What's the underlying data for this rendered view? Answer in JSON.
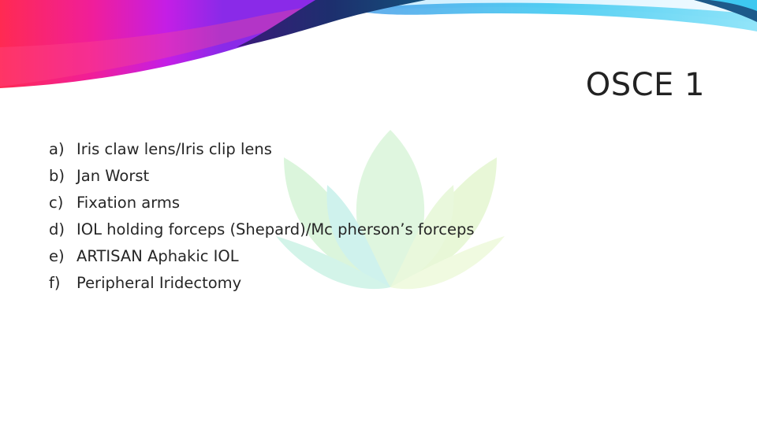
{
  "slide": {
    "title": "OSCE 1",
    "items": [
      {
        "marker": "a)",
        "text": "Iris claw lens/Iris clip lens"
      },
      {
        "marker": "b)",
        "text": "Jan Worst"
      },
      {
        "marker": "c)",
        "text": "Fixation arms"
      },
      {
        "marker": "d)",
        "text": "IOL holding forceps (Shepard)/Mc pherson’s forceps"
      },
      {
        "marker": "e)",
        "text": "ARTISAN Aphakic IOL"
      },
      {
        "marker": "f)",
        "text": "Peripheral Iridectomy"
      }
    ]
  },
  "colors": {
    "banner_left": "#ff1f5a",
    "banner_mid": "#c020e0",
    "banner_dark": "#1a2a6a",
    "banner_cyan": "#3ec8f0",
    "watermark_green": "#a8e6a0",
    "watermark_teal": "#9fe6e0",
    "text": "#262626"
  }
}
